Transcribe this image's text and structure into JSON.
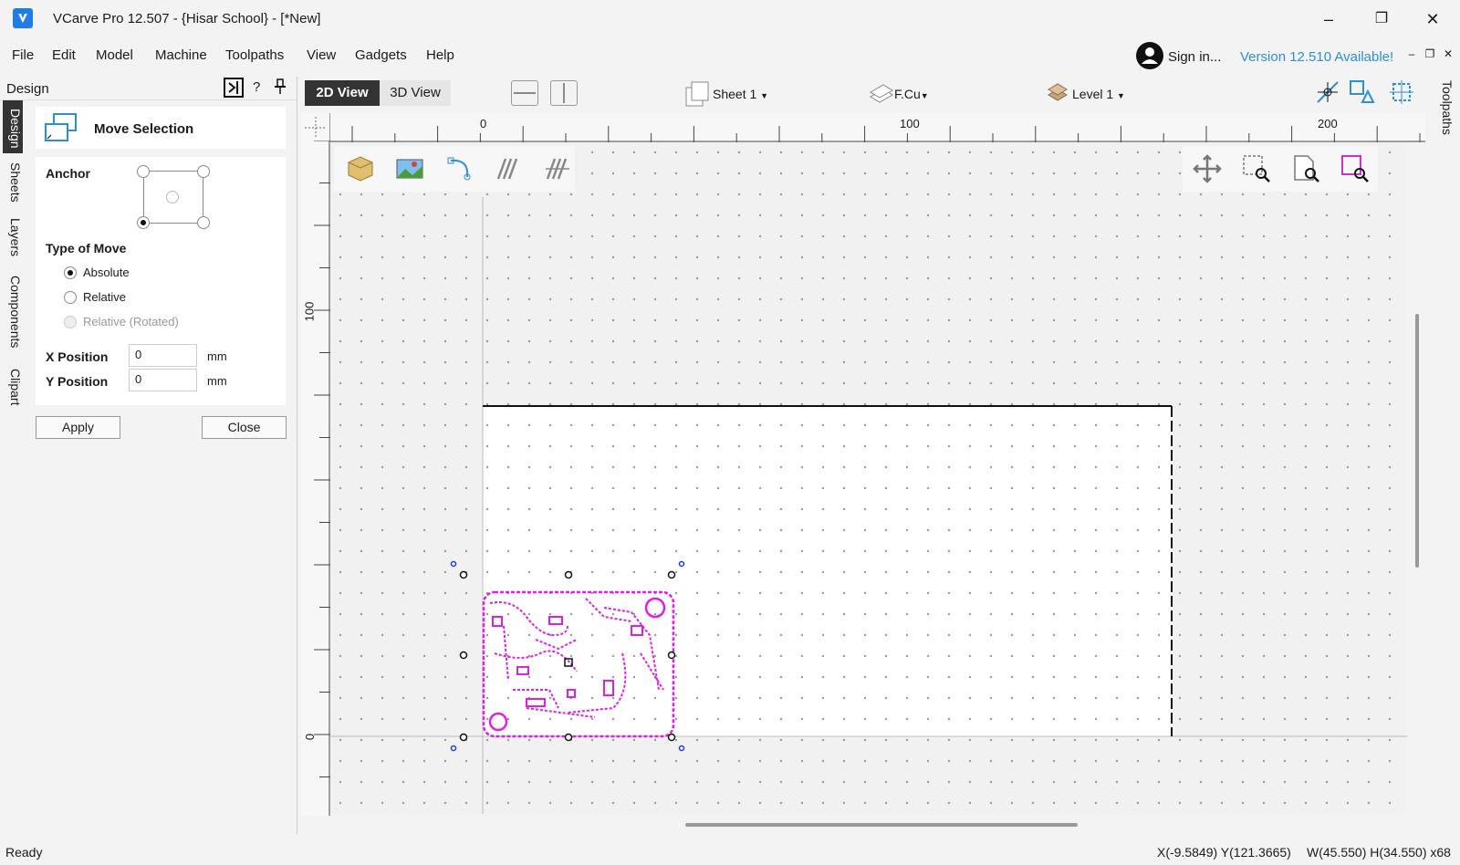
{
  "window": {
    "title": "VCarve Pro 12.507 - {Hisar School} - [*New]",
    "minimize": "–",
    "restore": "❐",
    "close": "✕"
  },
  "menu": [
    "File",
    "Edit",
    "Model",
    "Machine",
    "Toolpaths",
    "View",
    "Gadgets",
    "Help"
  ],
  "account": {
    "sign_in": "Sign in...",
    "version_notice": "Version 12.510 Available!"
  },
  "side_tabs": [
    "Design",
    "Sheets",
    "Layers",
    "Components",
    "Clipart"
  ],
  "panel": {
    "title": "Design",
    "help": "?",
    "tool_title": "Move Selection",
    "anchor_label": "Anchor",
    "type_of_move_label": "Type of Move",
    "move_options": [
      {
        "label": "Absolute",
        "checked": true,
        "disabled": false
      },
      {
        "label": "Relative",
        "checked": false,
        "disabled": false
      },
      {
        "label": "Relative (Rotated)",
        "checked": false,
        "disabled": true
      }
    ],
    "x_position_label": "X Position",
    "x_position_value": "0",
    "y_position_label": "Y Position",
    "y_position_value": "0",
    "unit": "mm",
    "apply_label": "Apply",
    "close_label": "Close"
  },
  "view_tabs": {
    "active": "2D View",
    "inactive": "3D View"
  },
  "view_toolbar": {
    "sheet": "Sheet 1",
    "layer": "F.Cu",
    "level": "Level 1"
  },
  "ruler": {
    "top_labels": [
      "0",
      "100",
      "200"
    ],
    "left_labels": [
      "100",
      "0"
    ]
  },
  "right_tab": "Toolpaths",
  "status": {
    "ready": "Ready",
    "coords": "X(-9.5849) Y(121.3665)",
    "size": "W(45.550) H(34.550) x68"
  },
  "colors": {
    "accent": "#1e7ee6",
    "selection": "#e020e0",
    "version_link": "#2b8fd6"
  }
}
